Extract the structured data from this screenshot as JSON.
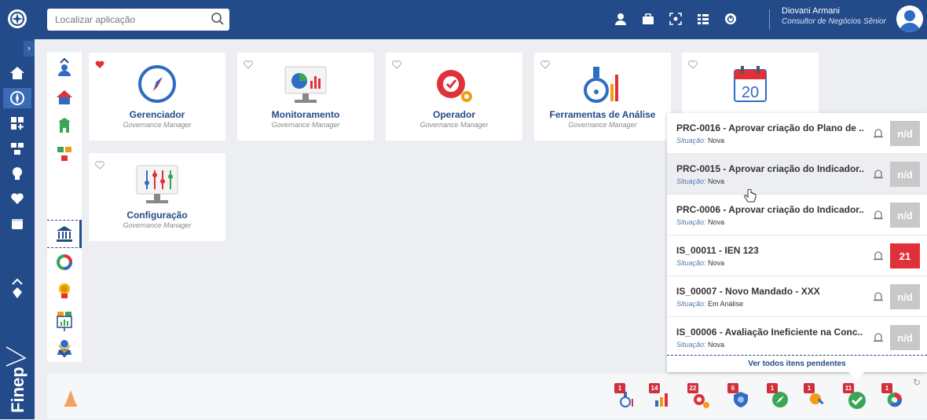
{
  "search": {
    "placeholder": "Localizar aplicação"
  },
  "user": {
    "name": "Diovani Armani",
    "role": "Consultor de Negócios Sênior"
  },
  "sidebar": {
    "brand": "Finep"
  },
  "tiles": [
    {
      "title": "Gerenciador",
      "subtitle": "Governance Manager",
      "favorite": true
    },
    {
      "title": "Monitoramento",
      "subtitle": "Governance Manager",
      "favorite": false
    },
    {
      "title": "Operador",
      "subtitle": "Governance Manager",
      "favorite": false
    },
    {
      "title": "Ferramentas de Análise",
      "subtitle": "Governance Manager",
      "favorite": false
    },
    {
      "title": "",
      "subtitle": "",
      "favorite": false,
      "icon_text": "20"
    },
    {
      "title": "Configuração",
      "subtitle": "Governance Manager",
      "favorite": false
    }
  ],
  "pending": {
    "situation_label": "Situação:",
    "items": [
      {
        "title": "PRC-0016 - Aprovar criação do Plano de ...",
        "status": "Nova",
        "badge": "n/d"
      },
      {
        "title": "PRC-0015 - Aprovar criação do Indicador...",
        "status": "Nova",
        "badge": "n/d"
      },
      {
        "title": "PRC-0006 - Aprovar criação do Indicador...",
        "status": "Nova",
        "badge": "n/d"
      },
      {
        "title": "IS_00011 - IEN 123",
        "status": "Nova",
        "badge": "21"
      },
      {
        "title": "IS_00007 - Novo Mandado - XXX",
        "status": "Em Análise",
        "badge": "n/d"
      },
      {
        "title": "IS_00006 - Avaliação Ineficiente na Conc...",
        "status": "Nova",
        "badge": "n/d"
      }
    ],
    "footer": "Ver todos itens pendentes"
  },
  "dock": [
    {
      "badge": "1",
      "icon": "flask-icon"
    },
    {
      "badge": "14",
      "icon": "bar-chart-icon"
    },
    {
      "badge": "22",
      "icon": "gears-icon"
    },
    {
      "badge": "6",
      "icon": "shield-icon"
    },
    {
      "badge": "1",
      "icon": "compass-icon"
    },
    {
      "badge": "1",
      "icon": "tools-icon"
    },
    {
      "badge": "11",
      "icon": "check-icon"
    },
    {
      "badge": "1",
      "icon": "cycle-icon"
    }
  ],
  "colors": {
    "primary": "#234b8a",
    "accent_red": "#e0313a",
    "badge_gray": "#c8c8c8"
  }
}
